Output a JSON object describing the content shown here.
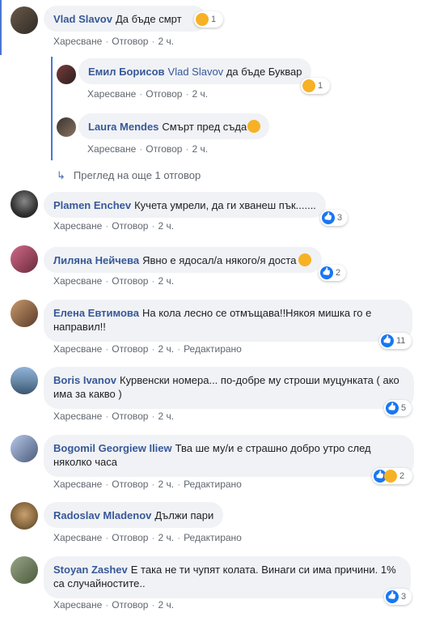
{
  "comments": [
    {
      "author": "Vlad Slavov",
      "text": "Да бъде смрт",
      "reaction_count": "1",
      "actions": [
        "Харесване",
        "Отговор",
        "2 ч."
      ]
    },
    {
      "author": "Plamen Enchev",
      "text": "Кучета умрели, да ги хванеш пък.......",
      "reaction_count": "3",
      "actions": [
        "Харесване",
        "Отговор",
        "2 ч."
      ]
    },
    {
      "author": "Лиляна Нейчева",
      "text": "Явно е ядосал/а някого/я доста",
      "reaction_count": "2",
      "actions": [
        "Харесване",
        "Отговор",
        "2 ч."
      ]
    },
    {
      "author": "Елена Евтимова",
      "text": "На кола лесно се отмъщава!!Някоя мишка го е направил!!",
      "reaction_count": "11",
      "actions": [
        "Харесване",
        "Отговор",
        "2 ч.",
        "Редактирано"
      ]
    },
    {
      "author": "Boris Ivanov",
      "text": "Курвенски номера... по-добре му строши муцунката ( ако има за какво )",
      "reaction_count": "5",
      "actions": [
        "Харесване",
        "Отговор",
        "2 ч."
      ]
    },
    {
      "author": "Bogomil Georgiew Iliew",
      "text": "Тва ше му/и е страшно добро утро след няколко часа",
      "reaction_count": "2",
      "actions": [
        "Харесване",
        "Отговор",
        "2 ч.",
        "Редактирано"
      ]
    },
    {
      "author": "Radoslav Mladenov",
      "text": "Дължи пари",
      "actions": [
        "Харесване",
        "Отговор",
        "2 ч.",
        "Редактирано"
      ]
    },
    {
      "author": "Stoyan Zashev",
      "text": "Е така не ти чупят колата. Винаги си има причини. 1% са случайностите..",
      "reaction_count": "3",
      "actions": [
        "Харесване",
        "Отговор",
        "2 ч."
      ]
    }
  ],
  "replies": [
    {
      "author": "Емил Борисов",
      "mention": "Vlad Slavov",
      "text": "да бъде Буквар",
      "reaction_count": "1",
      "actions": [
        "Харесване",
        "Отговор",
        "2 ч."
      ]
    },
    {
      "author": "Laura Mendes",
      "text": "Смърт пред съда",
      "actions": [
        "Харесване",
        "Отговор",
        "2 ч."
      ]
    }
  ],
  "more_replies": "Преглед на още 1 отговор",
  "colors": {
    "author": "#385898",
    "bubble": "#f0f2f5",
    "like": "#1877f2",
    "thread": "#4a76d1"
  }
}
